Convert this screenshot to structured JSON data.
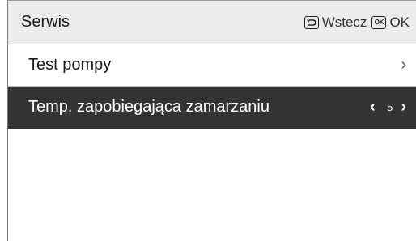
{
  "header": {
    "title": "Serwis",
    "back_label": "Wstecz",
    "back_icon": "back-arrow-icon",
    "ok_label": "OK",
    "ok_icon_text": "OK"
  },
  "menu": {
    "items": [
      {
        "label": "Test pompy",
        "trailing": "›"
      },
      {
        "label": "Temp. zapobiegająca zamarzaniu",
        "value": "-5",
        "left_arrow": "‹",
        "right_arrow": "›",
        "selected": true
      }
    ]
  },
  "colors": {
    "header_bg": "#ececec",
    "selected_bg": "#333333",
    "text": "#1a1a1a"
  }
}
